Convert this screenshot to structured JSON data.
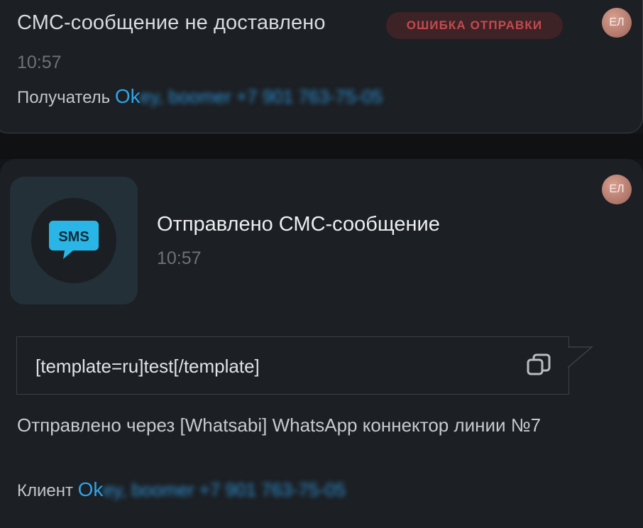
{
  "event_failed": {
    "title": "СМС-сообщение не доставлено",
    "badge": "ОШИБКА ОТПРАВКИ",
    "avatar": "ЕЛ",
    "time": "10:57",
    "recipient_label": "Получатель",
    "recipient_link": "Ok",
    "recipient_hidden": "ey, boomer +7 901 763-75-05"
  },
  "event_sent": {
    "icon": "sms-icon",
    "icon_text": "SMS",
    "title": "Отправлено СМС-сообщение",
    "time": "10:57",
    "avatar": "ЕЛ",
    "message": "[template=ru]test[/template]",
    "via": "Отправлено через [Whatsabi] WhatsApp коннектор линии №7",
    "client_label": "Клиент",
    "client_link": "Ok",
    "client_hidden": "ey, boomer +7 901 763-75-05"
  },
  "colors": {
    "accent_link": "#2fa4e7",
    "error_badge_bg": "#3e2326",
    "error_badge_text": "#c44a4f",
    "sms_icon": "#29b6e6"
  }
}
